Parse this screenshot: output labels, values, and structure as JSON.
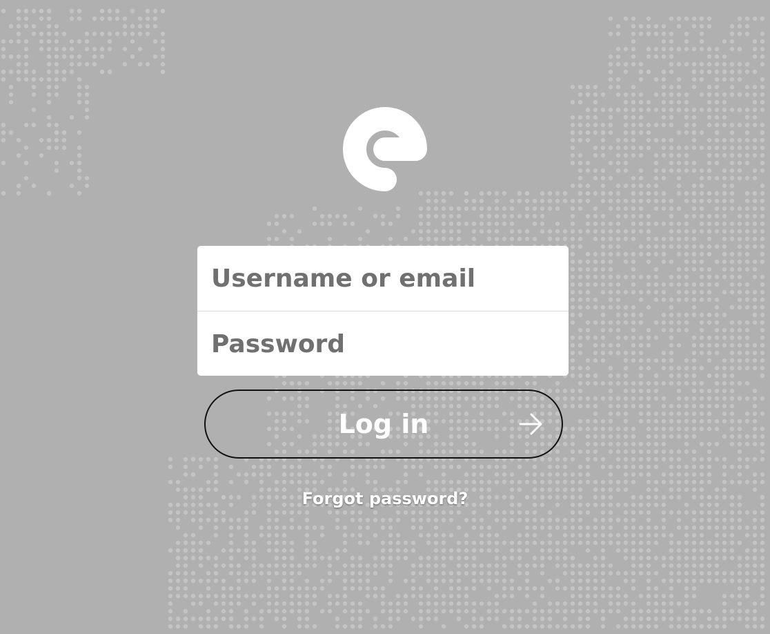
{
  "login": {
    "username_placeholder": "Username or email",
    "password_placeholder": "Password",
    "button_label": "Log in",
    "button_icon": "arrow-right-icon",
    "forgot_password_label": "Forgot password?"
  },
  "brand": {
    "logo_icon": "e-logo-icon",
    "logo_color": "#ffffff"
  },
  "colors": {
    "background": "#b0b0b0",
    "map_dots": "#c4c4c4",
    "card": "#ffffff",
    "placeholder": "#707070",
    "button_border": "#111111",
    "button_text": "#ffffff"
  }
}
